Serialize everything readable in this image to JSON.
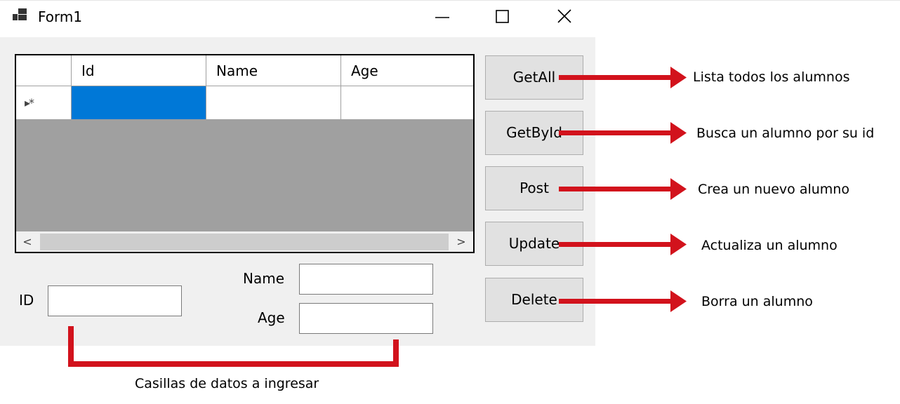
{
  "window": {
    "title": "Form1",
    "controls": {
      "minimize_icon": "minimize-icon",
      "maximize_icon": "maximize-icon",
      "close_icon": "close-icon"
    }
  },
  "grid": {
    "columns": [
      "Id",
      "Name",
      "Age"
    ],
    "new_row_glyph": "▸*",
    "scroll_left": "<",
    "scroll_right": ">"
  },
  "buttons": {
    "getall": "GetAll",
    "getbyid": "GetById",
    "post": "Post",
    "update": "Update",
    "delete": "Delete"
  },
  "fields": {
    "id_label": "ID",
    "name_label": "Name",
    "age_label": "Age",
    "id_value": "",
    "name_value": "",
    "age_value": ""
  },
  "annotations": {
    "getall": "Lista todos los alumnos",
    "getbyid": "Busca un alumno por su id",
    "post": "Crea un nuevo alumno",
    "update": "Actualiza un alumno",
    "delete": "Borra un alumno",
    "inputs": "Casillas de datos a ingresar"
  },
  "colors": {
    "selection": "#0078d7",
    "annotation_red": "#d2121c",
    "grid_bg": "#a0a0a0"
  }
}
